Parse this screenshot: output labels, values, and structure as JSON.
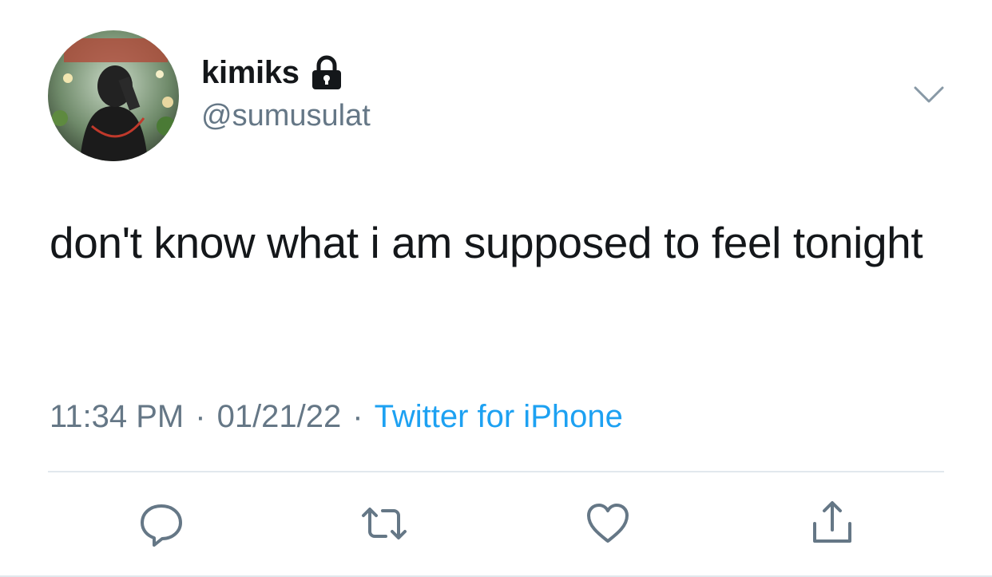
{
  "user": {
    "display_name": "kimiks",
    "handle": "@sumusulat",
    "verified_icon": "lock-icon",
    "avatar_icon": "avatar-photo"
  },
  "tweet": {
    "text": "don't know what i am supposed to feel tonight",
    "time": "11:34 PM",
    "date": "01/21/22",
    "separator": "·",
    "source": "Twitter for iPhone"
  },
  "menu": {
    "icon": "chevron-down-icon"
  },
  "actions": [
    {
      "name": "reply",
      "icon": "reply-icon"
    },
    {
      "name": "retweet",
      "icon": "retweet-icon"
    },
    {
      "name": "like",
      "icon": "heart-icon"
    },
    {
      "name": "share",
      "icon": "share-icon"
    }
  ],
  "colors": {
    "text": "#14171a",
    "secondary": "#657786",
    "accent": "#1da1f2",
    "divider": "#e1e8ed"
  }
}
